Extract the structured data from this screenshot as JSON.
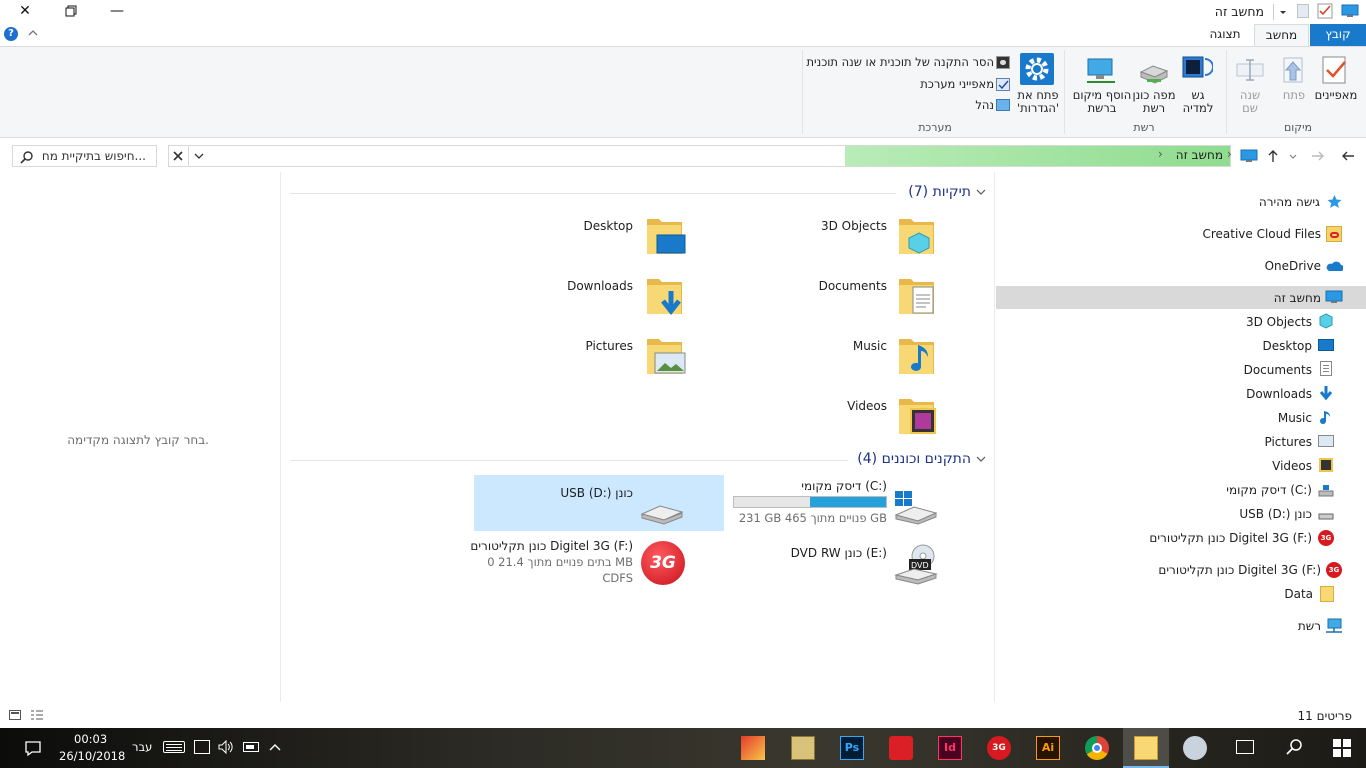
{
  "window": {
    "title": "מחשב זה",
    "status_items": "11 פריטים"
  },
  "ribbon": {
    "tabs": [
      "קובץ",
      "מחשב",
      "תצוגה"
    ],
    "location_group": {
      "label": "מיקום",
      "buttons": [
        {
          "label": "מאפיינים"
        },
        {
          "label": "פתח"
        },
        {
          "label_line1": "שנה",
          "label_line2": "שם"
        }
      ]
    },
    "network_group": {
      "label": "רשת",
      "buttons": [
        {
          "label_line1": "גש",
          "label_line2": "למדיה"
        },
        {
          "label_line1": "מפה כונן",
          "label_line2": "רשת"
        },
        {
          "label_line1": "הוסף מיקום",
          "label_line2": "ברשת"
        }
      ]
    },
    "system_group": {
      "label": "מערכת",
      "open_settings_line1": "פתח את",
      "open_settings_line2": "'הגדרות'",
      "items": [
        "הסר התקנה של תוכנית או שנה תוכנית",
        "מאפייני מערכת",
        "נהל"
      ]
    }
  },
  "address": {
    "path": "מחשב זה",
    "search_placeholder": "חיפוש בתיקיית מח..."
  },
  "nav_pane": {
    "quick_access": "גישה מהירה",
    "creative_cloud": "Creative Cloud Files",
    "onedrive": "OneDrive",
    "this_pc": "מחשב זה",
    "children": [
      "3D Objects",
      "Desktop",
      "Documents",
      "Downloads",
      "Music",
      "Pictures",
      "Videos",
      "דיסק מקומי (C:)",
      "USB (D:) כונן",
      "כונן תקליטורים Digitel 3G (F:)"
    ],
    "drive_f": "כונן תקליטורים Digitel 3G (F:)",
    "data": "Data",
    "network": "רשת"
  },
  "content": {
    "folders_header": "תיקיות (7)",
    "folders": [
      "3D Objects",
      "Desktop",
      "Documents",
      "Downloads",
      "Music",
      "Pictures",
      "Videos"
    ],
    "devices_header": "התקנים וכוננים (4)",
    "drive_c": {
      "name": "דיסק מקומי (C:)",
      "free": "231 GB פנויים מתוך 465 GB",
      "used_fraction": 0.5
    },
    "drive_d": {
      "name": "USB (D:) כונן"
    },
    "drive_e": {
      "name": "DVD RW כונן (E:)"
    },
    "drive_f": {
      "name": "כונן תקליטורים Digitel 3G (F:)",
      "free": "0 בתים פנויים מתוך 21.4 MB",
      "fs": "CDFS"
    },
    "preview_text": "בחר קובץ לתצוגה מקדימה."
  },
  "taskbar": {
    "time": "00:03",
    "date": "26/10/2018",
    "lang": "עבר"
  },
  "colors": {
    "accent": "#1979ca",
    "selection": "#cce8ff",
    "nav_selected": "#d9d9d9",
    "progress_green": "#8fdc8f",
    "drive_bar": "#26a0da",
    "header_blue": "#1e3287"
  }
}
